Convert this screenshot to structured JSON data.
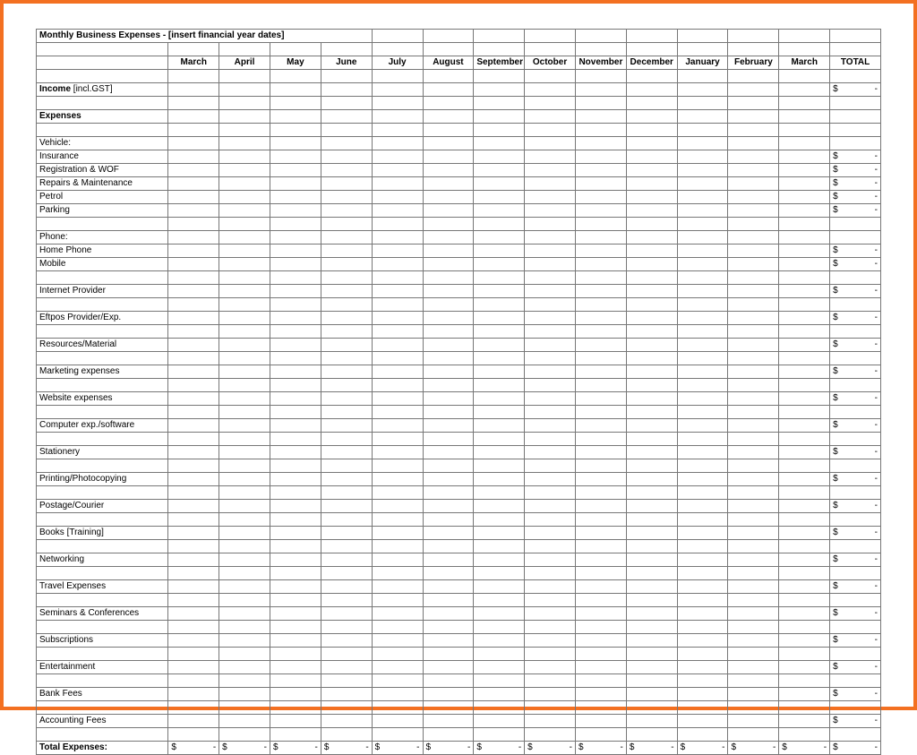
{
  "title": "Monthly Business Expenses - [insert financial year dates]",
  "months": [
    "March",
    "April",
    "May",
    "June",
    "July",
    "August",
    "September",
    "October",
    "November",
    "December",
    "January",
    "February",
    "March"
  ],
  "total_label": "TOTAL",
  "income_label": "Income [incl.GST]",
  "expenses_header": "Expenses",
  "total_expenses_label": "Total Expenses:",
  "currency": "$",
  "dash": "-",
  "rows": [
    {
      "type": "group",
      "label": "Vehicle:",
      "items": [
        {
          "label": "Insurance",
          "total": true
        },
        {
          "label": "Registration & WOF",
          "total": true
        },
        {
          "label": "Repairs & Maintenance",
          "total": true
        },
        {
          "label": "Petrol",
          "total": true
        },
        {
          "label": "Parking",
          "total": true
        }
      ]
    },
    {
      "type": "blank"
    },
    {
      "type": "group",
      "label": "Phone:",
      "items": [
        {
          "label": "Home Phone",
          "total": true
        },
        {
          "label": "Mobile",
          "total": true
        }
      ]
    },
    {
      "type": "blank"
    },
    {
      "type": "single",
      "label": "Internet Provider",
      "total": true
    },
    {
      "type": "blank"
    },
    {
      "type": "single",
      "label": "Eftpos Provider/Exp.",
      "total": true
    },
    {
      "type": "blank"
    },
    {
      "type": "single",
      "label": "Resources/Material",
      "total": true
    },
    {
      "type": "blank"
    },
    {
      "type": "single",
      "label": "Marketing expenses",
      "total": true
    },
    {
      "type": "blank"
    },
    {
      "type": "single",
      "label": "Website expenses",
      "total": true
    },
    {
      "type": "blank"
    },
    {
      "type": "single",
      "label": "Computer exp./software",
      "total": true
    },
    {
      "type": "blank"
    },
    {
      "type": "single",
      "label": "Stationery",
      "total": true
    },
    {
      "type": "blank"
    },
    {
      "type": "single",
      "label": "Printing/Photocopying",
      "total": true
    },
    {
      "type": "blank"
    },
    {
      "type": "single",
      "label": "Postage/Courier",
      "total": true
    },
    {
      "type": "blank"
    },
    {
      "type": "single",
      "label": "Books [Training]",
      "total": true
    },
    {
      "type": "blank"
    },
    {
      "type": "single",
      "label": "Networking",
      "total": true
    },
    {
      "type": "blank"
    },
    {
      "type": "single",
      "label": "Travel Expenses",
      "total": true
    },
    {
      "type": "blank"
    },
    {
      "type": "single",
      "label": "Seminars & Conferences",
      "total": true
    },
    {
      "type": "blank"
    },
    {
      "type": "single",
      "label": "Subscriptions",
      "total": true
    },
    {
      "type": "blank"
    },
    {
      "type": "single",
      "label": "Entertainment",
      "total": true
    },
    {
      "type": "blank"
    },
    {
      "type": "single",
      "label": "Bank Fees",
      "total": true
    },
    {
      "type": "blank"
    },
    {
      "type": "single",
      "label": "Accounting Fees",
      "total": true
    },
    {
      "type": "blank"
    }
  ]
}
